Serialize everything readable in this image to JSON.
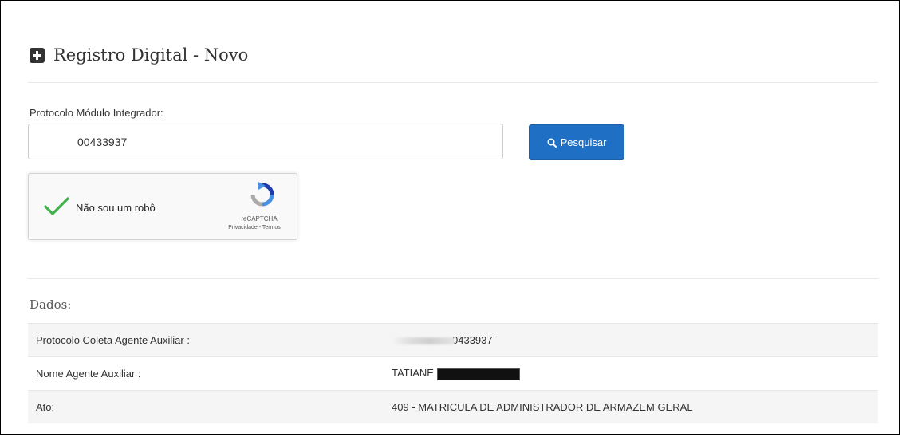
{
  "header": {
    "title": "Registro Digital - Novo"
  },
  "form": {
    "protocol_label": "Protocolo Módulo Integrador:",
    "protocol_value": "00433937",
    "search_button_label": "Pesquisar"
  },
  "captcha": {
    "label": "Não sou um robô",
    "brand": "reCAPTCHA",
    "links": "Privacidade - Termos",
    "checked": true
  },
  "details": {
    "section_title": "Dados:",
    "rows": [
      {
        "label": "Protocolo Coleta Agente Auxiliar :",
        "value": "0433937"
      },
      {
        "label": "Nome Agente Auxiliar :",
        "value": "TATIANE"
      },
      {
        "label": "Ato:",
        "value": "409 - MATRICULA DE ADMINISTRADOR DE ARMAZEM GERAL"
      }
    ]
  },
  "colors": {
    "primary_button": "#1f6fc5",
    "check_green": "#3fb24a"
  },
  "icons": {
    "header": "plus-square-icon",
    "search": "search-icon",
    "captcha_check": "checkmark-icon",
    "captcha_logo": "recaptcha-logo-icon"
  }
}
